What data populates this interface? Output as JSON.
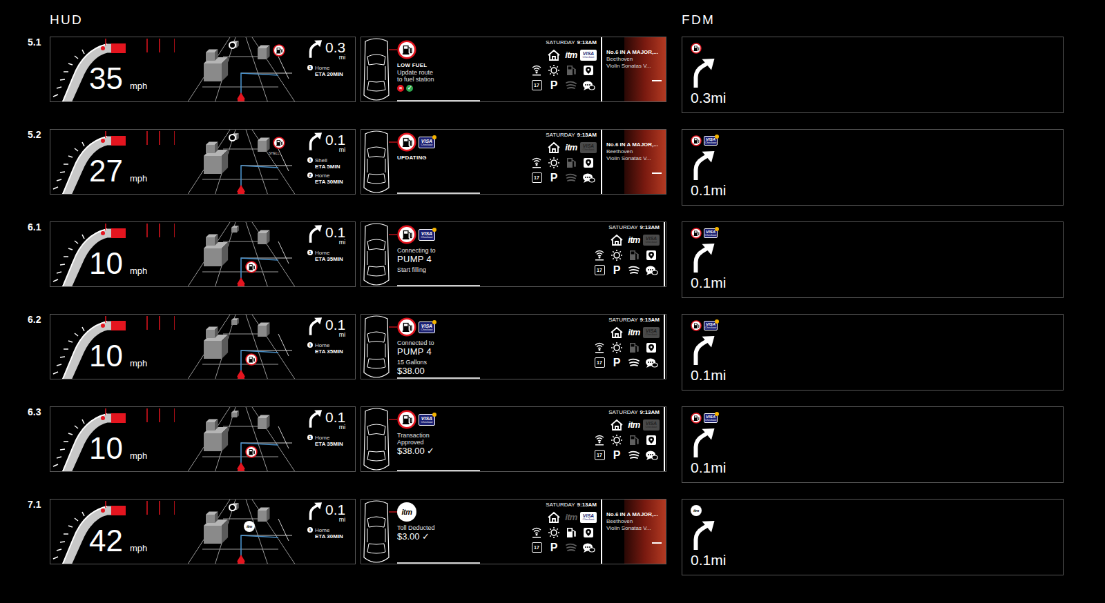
{
  "headers": {
    "hud": "HUD",
    "fdm": "FDM"
  },
  "units": {
    "speed": "mph",
    "distance": "mi"
  },
  "clock": {
    "day": "SATURDAY",
    "time": "9:13AM"
  },
  "brand": {
    "toll": "itm",
    "visa": "VISA",
    "visaSub": "Checkout",
    "calendar": "17",
    "parking": "P"
  },
  "music": {
    "title": "No.6 IN A MAJOR,...",
    "artist": "Beethoven",
    "album": "Violin Sonatas V..."
  },
  "rows": [
    {
      "id": "5.1",
      "speed": "35",
      "distance": "0.3",
      "destinations": [
        {
          "num": "1",
          "name": "Home",
          "eta": "ETA 20MIN"
        }
      ],
      "poi": "fuel",
      "placement": "ahead",
      "poiLabel": "",
      "landmark": true,
      "alert": "fuel",
      "visa": false,
      "status": [
        {
          "text": "LOW FUEL",
          "style": "bold"
        },
        {
          "text": "Update route",
          "style": "normal"
        },
        {
          "text": "to fuel station",
          "style": "normal"
        }
      ],
      "actions": [
        {
          "glyph": "×",
          "color": "#e4151f"
        },
        {
          "glyph": "✓",
          "color": "#2fa84f"
        }
      ],
      "showMusic": true,
      "apps": [
        {
          "kind": "home",
          "dimmed": false
        },
        {
          "kind": "toll",
          "dimmed": false
        },
        {
          "kind": "visa",
          "dimmed": false
        },
        {
          "kind": "radio",
          "dimmed": false
        },
        {
          "kind": "weather",
          "dimmed": false
        },
        {
          "kind": "fuel",
          "dimmed": true
        },
        {
          "kind": "map",
          "dimmed": false
        },
        {
          "kind": "calendar",
          "dimmed": false
        },
        {
          "kind": "parking",
          "dimmed": false
        },
        {
          "kind": "music",
          "dimmed": true
        },
        {
          "kind": "chat",
          "dimmed": false
        }
      ]
    },
    {
      "id": "5.2",
      "speed": "27",
      "distance": "0.1",
      "destinations": [
        {
          "num": "1",
          "name": "Shell",
          "eta": "ETA 5MIN"
        },
        {
          "num": "2",
          "name": "Home",
          "eta": "ETA 30MIN"
        }
      ],
      "poi": "fuel",
      "placement": "ahead",
      "poiLabel": "SHELL",
      "landmark": true,
      "alert": "fuel",
      "visa": true,
      "status": [
        {
          "text": "UPDATING",
          "style": "bold"
        }
      ],
      "actions": [],
      "showMusic": true,
      "apps": [
        {
          "kind": "home",
          "dimmed": false
        },
        {
          "kind": "toll",
          "dimmed": false
        },
        {
          "kind": "visa",
          "dimmed": true
        },
        {
          "kind": "radio",
          "dimmed": false
        },
        {
          "kind": "weather",
          "dimmed": false
        },
        {
          "kind": "fuel",
          "dimmed": true
        },
        {
          "kind": "map",
          "dimmed": false
        },
        {
          "kind": "calendar",
          "dimmed": false
        },
        {
          "kind": "parking",
          "dimmed": false
        },
        {
          "kind": "music",
          "dimmed": true
        },
        {
          "kind": "chat",
          "dimmed": false
        }
      ]
    },
    {
      "id": "6.1",
      "speed": "10",
      "distance": "0.1",
      "destinations": [
        {
          "num": "1",
          "name": "Home",
          "eta": "ETA 35MIN"
        }
      ],
      "poi": "fuel",
      "placement": "near",
      "poiLabel": "",
      "landmark": false,
      "alert": "fuel",
      "visa": true,
      "status": [
        {
          "text": "Connecting to",
          "style": "normal"
        },
        {
          "text": "PUMP 4",
          "style": "large"
        },
        {
          "text": "Start filling",
          "style": "normal"
        }
      ],
      "actions": [],
      "showMusic": false,
      "apps": [
        {
          "kind": "home",
          "dimmed": false
        },
        {
          "kind": "toll",
          "dimmed": false
        },
        {
          "kind": "visa",
          "dimmed": true
        },
        {
          "kind": "radio",
          "dimmed": false
        },
        {
          "kind": "weather",
          "dimmed": false
        },
        {
          "kind": "fuel",
          "dimmed": true
        },
        {
          "kind": "map",
          "dimmed": false
        },
        {
          "kind": "calendar",
          "dimmed": false
        },
        {
          "kind": "parking",
          "dimmed": false
        },
        {
          "kind": "music",
          "dimmed": false
        },
        {
          "kind": "chat",
          "dimmed": false
        }
      ]
    },
    {
      "id": "6.2",
      "speed": "10",
      "distance": "0.1",
      "destinations": [
        {
          "num": "1",
          "name": "Home",
          "eta": "ETA 35MIN"
        }
      ],
      "poi": "fuel",
      "placement": "near",
      "poiLabel": "",
      "landmark": false,
      "alert": "fuel",
      "visa": true,
      "status": [
        {
          "text": "Connected to",
          "style": "normal"
        },
        {
          "text": "PUMP 4",
          "style": "large"
        },
        {
          "text": "15 Gallons",
          "style": "normal"
        },
        {
          "text": "$38.00",
          "style": "amount"
        }
      ],
      "actions": [],
      "showMusic": false,
      "apps": [
        {
          "kind": "home",
          "dimmed": false
        },
        {
          "kind": "toll",
          "dimmed": false
        },
        {
          "kind": "visa",
          "dimmed": true
        },
        {
          "kind": "radio",
          "dimmed": false
        },
        {
          "kind": "weather",
          "dimmed": false
        },
        {
          "kind": "fuel",
          "dimmed": true
        },
        {
          "kind": "map",
          "dimmed": false
        },
        {
          "kind": "calendar",
          "dimmed": false
        },
        {
          "kind": "parking",
          "dimmed": false
        },
        {
          "kind": "music",
          "dimmed": false
        },
        {
          "kind": "chat",
          "dimmed": false
        }
      ]
    },
    {
      "id": "6.3",
      "speed": "10",
      "distance": "0.1",
      "destinations": [
        {
          "num": "1",
          "name": "Home",
          "eta": "ETA 35MIN"
        }
      ],
      "poi": "fuel",
      "placement": "near",
      "poiLabel": "",
      "landmark": false,
      "alert": "fuel",
      "visa": true,
      "status": [
        {
          "text": "Transaction",
          "style": "normal"
        },
        {
          "text": "Approved",
          "style": "normal"
        },
        {
          "text": "$38.00 ✓",
          "style": "amount"
        }
      ],
      "actions": [],
      "showMusic": false,
      "apps": [
        {
          "kind": "home",
          "dimmed": false
        },
        {
          "kind": "toll",
          "dimmed": false
        },
        {
          "kind": "visa",
          "dimmed": true
        },
        {
          "kind": "radio",
          "dimmed": false
        },
        {
          "kind": "weather",
          "dimmed": false
        },
        {
          "kind": "fuel",
          "dimmed": true
        },
        {
          "kind": "map",
          "dimmed": false
        },
        {
          "kind": "calendar",
          "dimmed": false
        },
        {
          "kind": "parking",
          "dimmed": false
        },
        {
          "kind": "music",
          "dimmed": false
        },
        {
          "kind": "chat",
          "dimmed": false
        }
      ]
    },
    {
      "id": "7.1",
      "speed": "42",
      "distance": "0.1",
      "destinations": [
        {
          "num": "1",
          "name": "Home",
          "eta": "ETA 30MIN"
        }
      ],
      "poi": "toll",
      "placement": "mid",
      "poiLabel": "",
      "landmark": true,
      "alert": "toll",
      "visa": false,
      "status": [
        {
          "text": "Toll Deducted",
          "style": "normal"
        },
        {
          "text": "$3.00 ✓",
          "style": "amount"
        }
      ],
      "actions": [],
      "showMusic": true,
      "apps": [
        {
          "kind": "home",
          "dimmed": false
        },
        {
          "kind": "toll",
          "dimmed": true
        },
        {
          "kind": "visa",
          "dimmed": false
        },
        {
          "kind": "radio",
          "dimmed": false
        },
        {
          "kind": "weather",
          "dimmed": false
        },
        {
          "kind": "fuel",
          "dimmed": false
        },
        {
          "kind": "map",
          "dimmed": false
        },
        {
          "kind": "calendar",
          "dimmed": false
        },
        {
          "kind": "parking",
          "dimmed": false
        },
        {
          "kind": "music",
          "dimmed": true
        },
        {
          "kind": "chat",
          "dimmed": false
        }
      ]
    }
  ]
}
